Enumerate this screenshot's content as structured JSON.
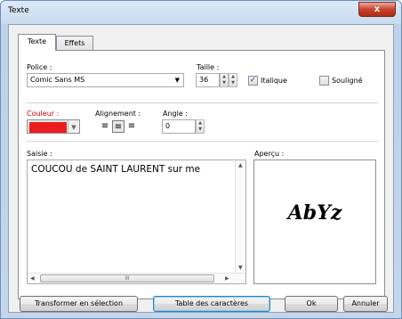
{
  "window": {
    "title": "Texte",
    "close_label": "x"
  },
  "tabs": [
    {
      "label": "Texte",
      "active": true
    },
    {
      "label": "Effets",
      "active": false
    }
  ],
  "font": {
    "label": "Police :",
    "value": "Comic Sans MS",
    "size_label": "Taille :",
    "size_value": "36",
    "italic_label": "Italique",
    "italic_checked": true,
    "underline_label": "Souligné",
    "underline_checked": false
  },
  "color": {
    "label": "Couleur :",
    "value": "#ee1c1c"
  },
  "alignment": {
    "label": "Alignement :",
    "options": [
      "left",
      "center",
      "right"
    ],
    "selected": "center"
  },
  "angle": {
    "label": "Angle :",
    "value": "0"
  },
  "input": {
    "label": "Saisie :",
    "text": "COUCOU de SAINT LAURENT sur me",
    "hscroll_thumb": "III"
  },
  "preview": {
    "label": "Aperçu :",
    "text": "AbYz"
  },
  "buttons": {
    "transform": "Transformer en sélection",
    "charmap": "Table des caractères",
    "ok": "Ok",
    "cancel": "Annuler"
  },
  "icons": {
    "close": "close-icon",
    "dropdown": "chevron-down-icon",
    "spin_up": "spin-up-icon",
    "spin_down": "spin-down-icon",
    "check": "checkmark-icon",
    "align_left": "align-left-icon",
    "align_center": "align-center-icon",
    "align_right": "align-right-icon"
  }
}
